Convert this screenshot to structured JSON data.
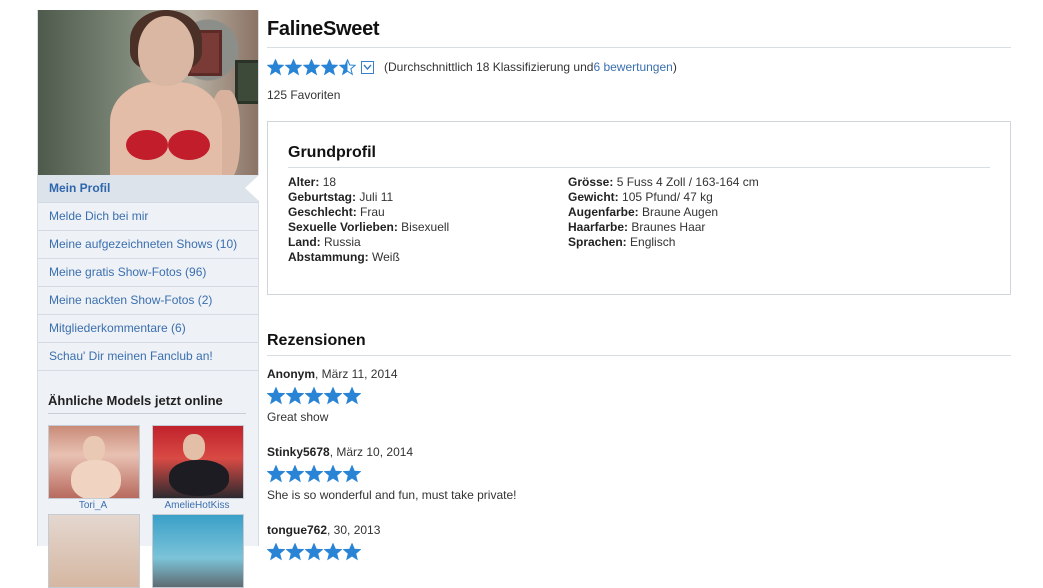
{
  "colors": {
    "link": "#3a6fb0",
    "star": "#2a84d6",
    "sidebar_bg": "#eef1f5"
  },
  "sidebar": {
    "photo_icon": "model-photo",
    "menu": [
      {
        "label": "Mein Profil",
        "active": true
      },
      {
        "label": "Melde Dich bei mir"
      },
      {
        "label": "Meine aufgezeichneten Shows (10)"
      },
      {
        "label": "Meine gratis Show-Fotos (96)"
      },
      {
        "label": "Meine nackten Show-Fotos (2)"
      },
      {
        "label": "Mitgliederkommentare (6)"
      },
      {
        "label": "Schau' Dir meinen Fanclub an!"
      }
    ],
    "similar": {
      "title": "Ähnliche Models jetzt online",
      "models": [
        {
          "name": "Tori_A"
        },
        {
          "name": "AmelieHotKiss"
        },
        {
          "name": ""
        },
        {
          "name": ""
        }
      ]
    }
  },
  "profile": {
    "name": "FalineSweet",
    "rating": {
      "stars": 4.5,
      "prefix": "(Durchschnittlich 18 Klassifizierung und ",
      "count_link": "6 bewertungen",
      "suffix": ")"
    },
    "favorites": "125 Favoriten"
  },
  "grundprofil": {
    "title": "Grundprofil",
    "left": [
      {
        "label": "Alter:",
        "value": "18"
      },
      {
        "label": "Geburtstag:",
        "value": "Juli 11"
      },
      {
        "label": "Geschlecht:",
        "value": "Frau"
      },
      {
        "label": "Sexuelle Vorlieben:",
        "value": "Bisexuell"
      },
      {
        "label": "Land:",
        "value": "Russia"
      },
      {
        "label": "Abstammung:",
        "value": "Weiß"
      }
    ],
    "right": [
      {
        "label": "Grösse:",
        "value": "5 Fuss 4 Zoll / 163-164 cm"
      },
      {
        "label": "Gewicht:",
        "value": "105 Pfund/ 47 kg"
      },
      {
        "label": "Augenfarbe:",
        "value": "Braune Augen"
      },
      {
        "label": "Haarfarbe:",
        "value": "Braunes Haar"
      },
      {
        "label": "Sprachen:",
        "value": "Englisch"
      }
    ]
  },
  "reviews": {
    "title": "Rezensionen",
    "items": [
      {
        "author": "Anonym",
        "date": ", März 11, 2014",
        "stars": 5,
        "text": "Great show"
      },
      {
        "author": "Stinky5678",
        "date": ", März 10, 2014",
        "stars": 5,
        "text": "She is so wonderful and fun, must take private!"
      },
      {
        "author": "tongue762",
        "date": ", 30, 2013",
        "stars": 5,
        "text": ""
      }
    ]
  }
}
